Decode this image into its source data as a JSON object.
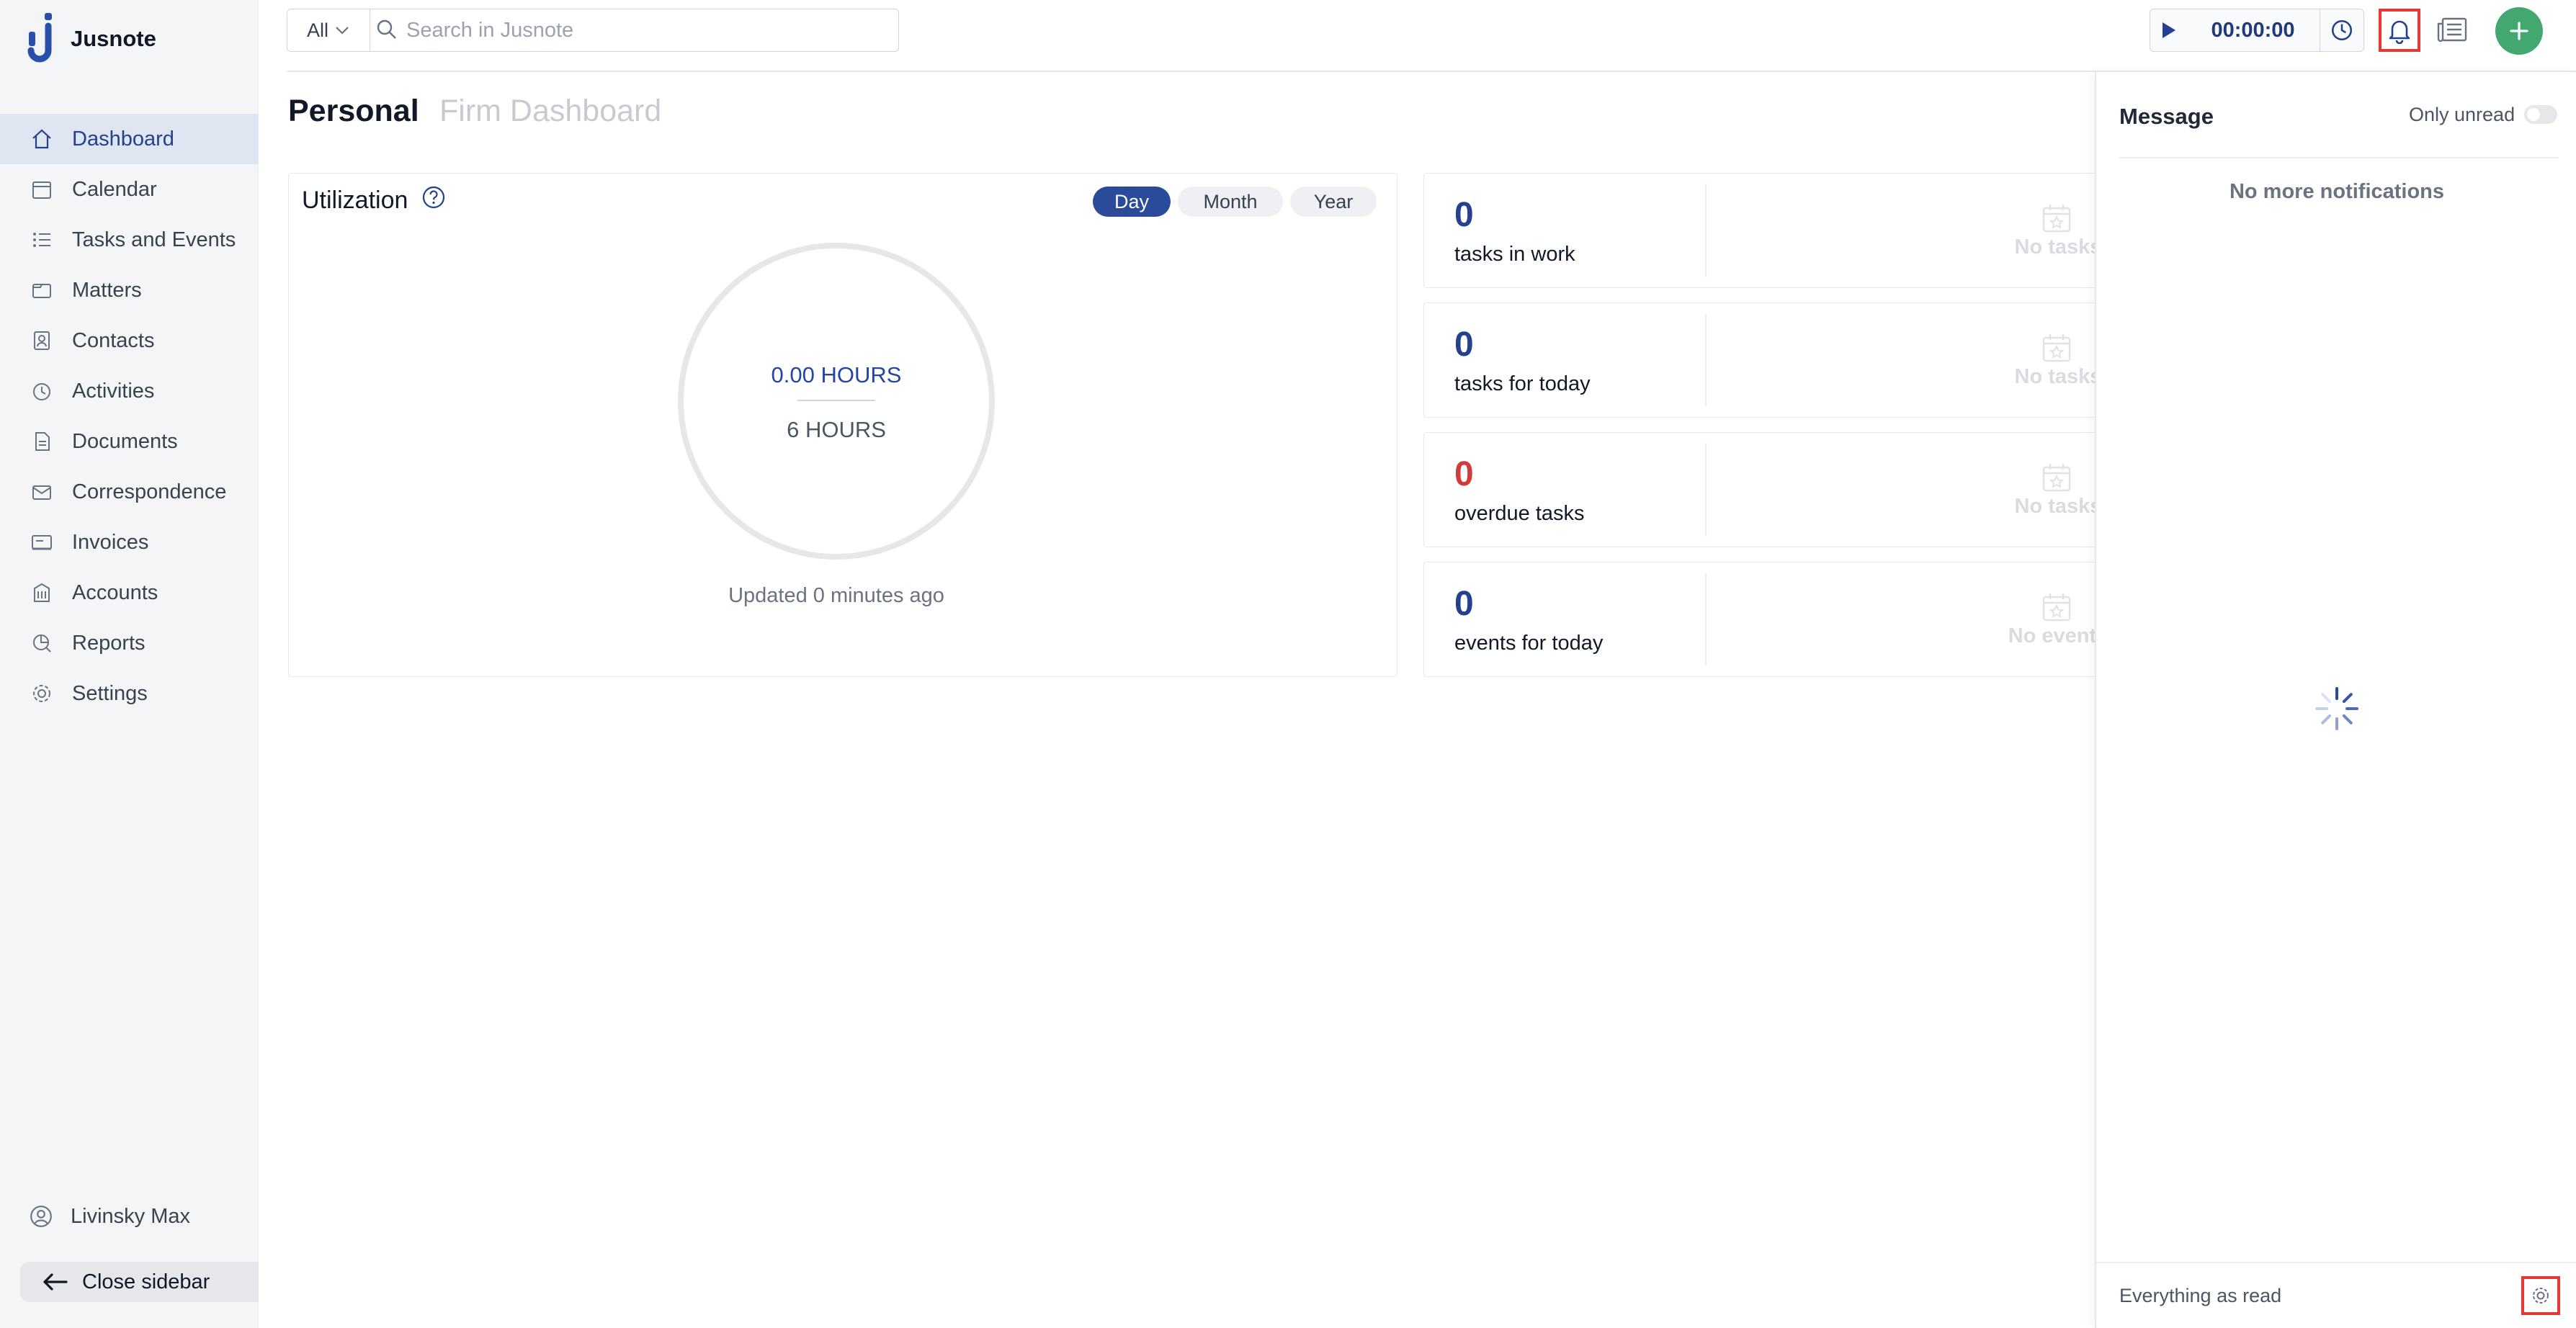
{
  "app": {
    "name": "Jusnote"
  },
  "sidebar": {
    "items": [
      {
        "label": "Dashboard",
        "icon": "home-icon",
        "active": true
      },
      {
        "label": "Calendar",
        "icon": "calendar-icon",
        "active": false
      },
      {
        "label": "Tasks and Events",
        "icon": "tasks-icon",
        "active": false
      },
      {
        "label": "Matters",
        "icon": "matters-icon",
        "active": false
      },
      {
        "label": "Contacts",
        "icon": "contacts-icon",
        "active": false
      },
      {
        "label": "Activities",
        "icon": "activities-icon",
        "active": false
      },
      {
        "label": "Documents",
        "icon": "documents-icon",
        "active": false
      },
      {
        "label": "Correspondence",
        "icon": "correspondence-icon",
        "active": false
      },
      {
        "label": "Invoices",
        "icon": "invoices-icon",
        "active": false
      },
      {
        "label": "Accounts",
        "icon": "accounts-icon",
        "active": false
      },
      {
        "label": "Reports",
        "icon": "reports-icon",
        "active": false
      },
      {
        "label": "Settings",
        "icon": "settings-icon",
        "active": false
      }
    ],
    "user": "Livinsky Max",
    "close_label": "Close sidebar"
  },
  "topbar": {
    "scope": "All",
    "search_placeholder": "Search in Jusnote",
    "timer": "00:00:00"
  },
  "tabs": {
    "personal": "Personal",
    "firm": "Firm Dashboard"
  },
  "utilization": {
    "title": "Utilization",
    "periods": [
      "Day",
      "Month",
      "Year"
    ],
    "selected_period": "Day",
    "worked": "0.00 HOURS",
    "target": "6 HOURS",
    "updated": "Updated 0 minutes ago"
  },
  "stats": [
    {
      "value": "0",
      "label": "tasks in work",
      "empty": "No tasks"
    },
    {
      "value": "0",
      "label": "tasks for today",
      "empty": "No tasks"
    },
    {
      "value": "0",
      "label": "overdue tasks",
      "empty": "No tasks"
    },
    {
      "value": "0",
      "label": "events for today",
      "empty": "No events"
    }
  ],
  "notifications": {
    "title": "Message",
    "only_unread": "Only unread",
    "only_unread_on": false,
    "empty": "No more notifications",
    "mark_all": "Everything as read"
  },
  "colors": {
    "primary": "#24408e",
    "accent_green": "#43a870",
    "danger": "#d23b3b",
    "highlight": "#e53935"
  }
}
